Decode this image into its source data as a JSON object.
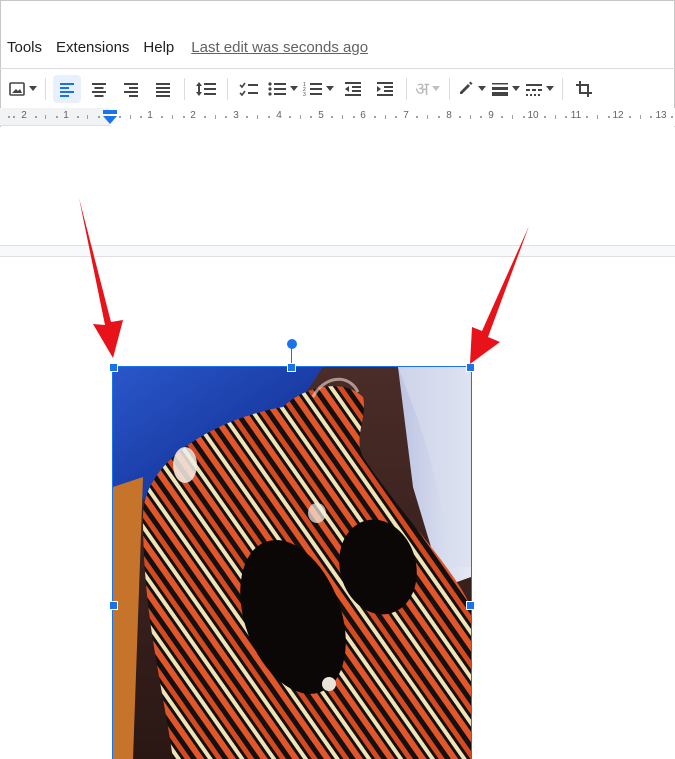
{
  "menu": {
    "items": [
      "Tools",
      "Extensions",
      "Help"
    ],
    "last_edit": "Last edit was seconds ago"
  },
  "toolbar": {
    "buttons": [
      {
        "name": "insert-image",
        "icon": "image-icon",
        "has_caret": true
      },
      {
        "name": "align-left",
        "icon": "align-left-icon",
        "active": true
      },
      {
        "name": "align-center",
        "icon": "align-center-icon"
      },
      {
        "name": "align-right",
        "icon": "align-right-icon"
      },
      {
        "name": "align-justify",
        "icon": "align-justify-icon"
      },
      {
        "name": "line-spacing",
        "icon": "line-spacing-icon"
      },
      {
        "name": "checklist",
        "icon": "checklist-icon"
      },
      {
        "name": "bulleted-list",
        "icon": "bulleted-list-icon",
        "has_caret": true
      },
      {
        "name": "numbered-list",
        "icon": "numbered-list-icon",
        "has_caret": true
      },
      {
        "name": "decrease-indent",
        "icon": "decrease-indent-icon"
      },
      {
        "name": "increase-indent",
        "icon": "increase-indent-icon"
      },
      {
        "name": "input-tools",
        "icon": "hindi-input-icon",
        "label": "अ",
        "has_caret": true,
        "disabled": true
      },
      {
        "name": "border-color",
        "icon": "pencil-icon",
        "has_caret": true
      },
      {
        "name": "border-weight",
        "icon": "border-weight-icon",
        "has_caret": true
      },
      {
        "name": "border-dash",
        "icon": "border-dash-icon",
        "has_caret": true
      },
      {
        "name": "crop",
        "icon": "crop-icon"
      }
    ]
  },
  "ruler": {
    "labels": [
      "2",
      "1",
      "1",
      "2",
      "3",
      "4",
      "5",
      "6",
      "7",
      "8",
      "9",
      "10",
      "11",
      "12",
      "13"
    ]
  },
  "colors": {
    "accent": "#1a73e8",
    "annotation_arrow": "#e8121b"
  },
  "image": {
    "description_icon": "photo-of-striped-clay-figure"
  }
}
